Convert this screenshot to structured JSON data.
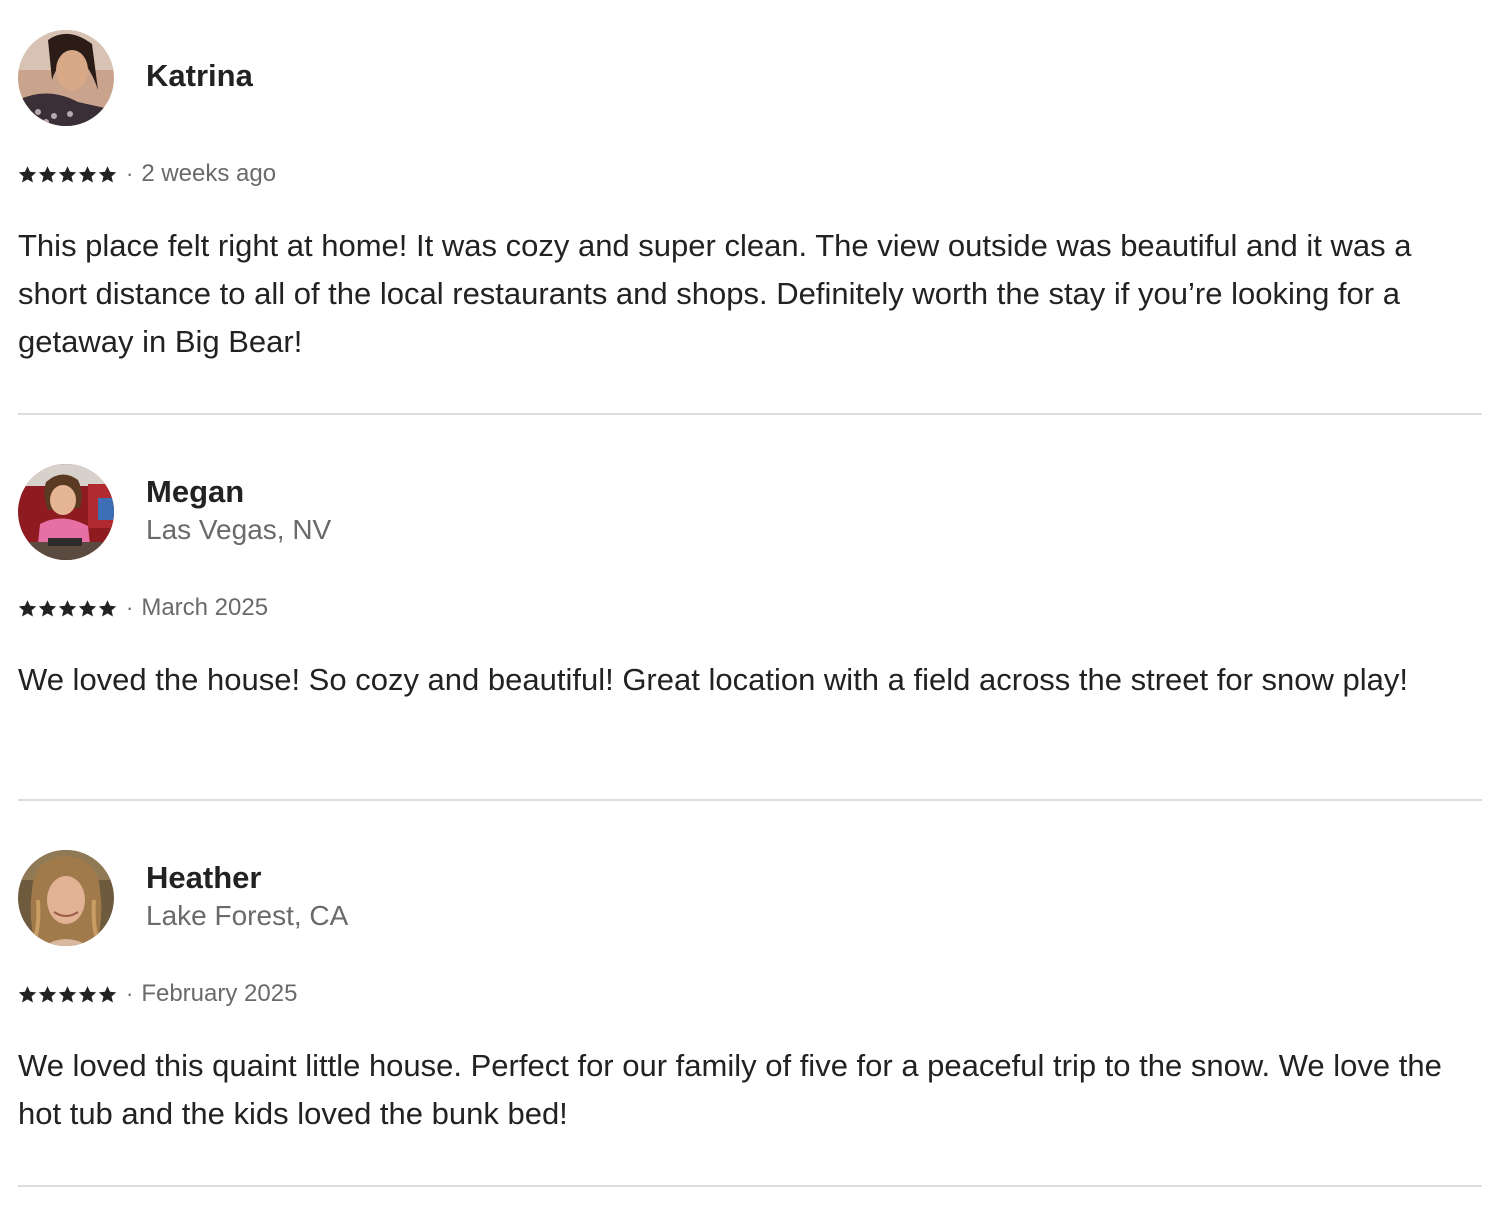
{
  "reviews": [
    {
      "name": "Katrina",
      "location": "",
      "rating": 5,
      "separator": "·",
      "date": "2 weeks ago",
      "text": "This place felt right at home! It was cozy and super clean. The view outside was beautiful and it was a short distance to all of the local restaurants and shops. Definitely worth the stay if you’re looking for a getaway in Big Bear!"
    },
    {
      "name": "Megan",
      "location": "Las Vegas, NV",
      "rating": 5,
      "separator": "·",
      "date": "March 2025",
      "text": "We loved the house! So cozy and beautiful! Great location with a field across the street for snow play!"
    },
    {
      "name": "Heather",
      "location": "Lake Forest, CA",
      "rating": 5,
      "separator": "·",
      "date": "February 2025",
      "text": "We loved this quaint little house. Perfect for our family of five for a peaceful trip to the snow. We love the hot tub and the kids loved the bunk bed!"
    }
  ],
  "icons": {
    "star": "star-icon",
    "avatar": "avatar"
  },
  "colors": {
    "text_primary": "#222222",
    "text_secondary": "#6a6a6a",
    "divider": "#dddddd"
  }
}
